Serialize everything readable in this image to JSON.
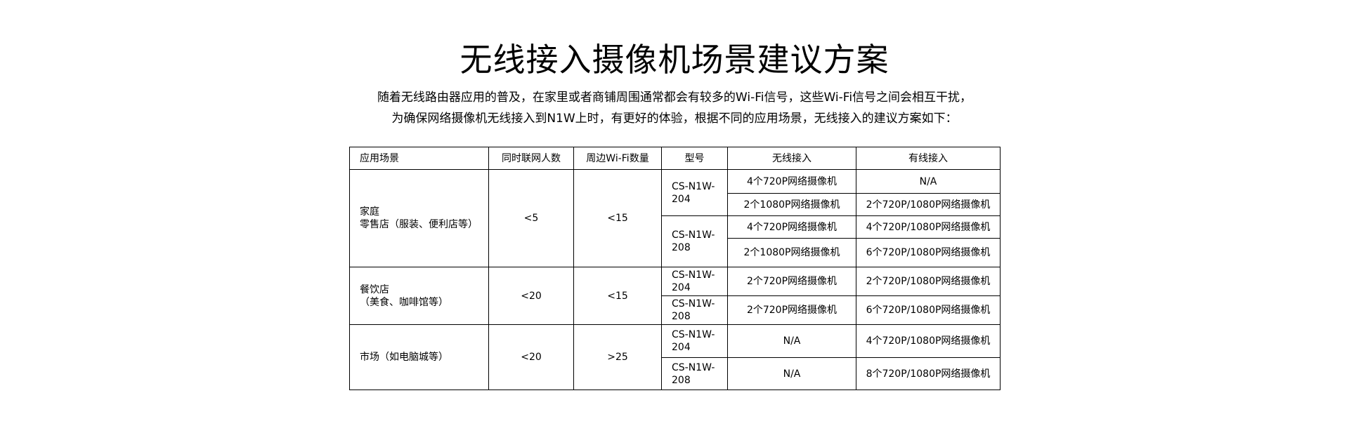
{
  "title": "无线接入摄像机场景建议方案",
  "intro": {
    "line1": "随着无线路由器应用的普及，在家里或者商铺周围通常都会有较多的Wi-Fi信号，这些Wi-Fi信号之间会相互干扰，",
    "line2": "为确保网络摄像机无线接入到N1W上时，有更好的体验，根据不同的应用场景，无线接入的建议方案如下："
  },
  "table": {
    "headers": [
      "应用场景",
      "同时联网人数",
      "周边Wi-Fi数量",
      "型号",
      "无线接入",
      "有线接入"
    ],
    "groups": [
      {
        "scene_lines": [
          "家庭",
          "零售店（服装、便利店等）"
        ],
        "users": "<5",
        "wifi": "<15",
        "models": [
          {
            "model_lines": [
              "CS-N1W-",
              "204"
            ],
            "rows": [
              {
                "wireless": "4个720P网络摄像机",
                "wired": "N/A"
              },
              {
                "wireless": "2个1080P网络摄像机",
                "wired": "2个720P/1080P网络摄像机"
              }
            ]
          },
          {
            "model_lines": [
              "CS-N1W-",
              "208"
            ],
            "rows": [
              {
                "wireless": "4个720P网络摄像机",
                "wired": "4个720P/1080P网络摄像机"
              },
              {
                "wireless": "2个1080P网络摄像机",
                "wired": "6个720P/1080P网络摄像机"
              }
            ]
          }
        ]
      },
      {
        "scene_lines": [
          "餐饮店",
          "（美食、咖啡馆等）"
        ],
        "users": "<20",
        "wifi": "<15",
        "models": [
          {
            "model_lines": [
              "CS-N1W-",
              "204"
            ],
            "rows": [
              {
                "wireless": "2个720P网络摄像机",
                "wired": "2个720P/1080P网络摄像机"
              }
            ]
          },
          {
            "model_lines": [
              "CS-N1W-",
              "208"
            ],
            "rows": [
              {
                "wireless": "2个720P网络摄像机",
                "wired": "6个720P/1080P网络摄像机"
              }
            ]
          }
        ]
      },
      {
        "scene_lines": [
          "市场（如电脑城等）"
        ],
        "users": "<20",
        "wifi": ">25",
        "models": [
          {
            "model_lines": [
              "CS-N1W-",
              "204"
            ],
            "rows": [
              {
                "wireless": "N/A",
                "wired": "4个720P/1080P网络摄像机"
              }
            ]
          },
          {
            "model_lines": [
              "CS-N1W-",
              "208"
            ],
            "rows": [
              {
                "wireless": "N/A",
                "wired": "8个720P/1080P网络摄像机"
              }
            ]
          }
        ]
      }
    ]
  }
}
